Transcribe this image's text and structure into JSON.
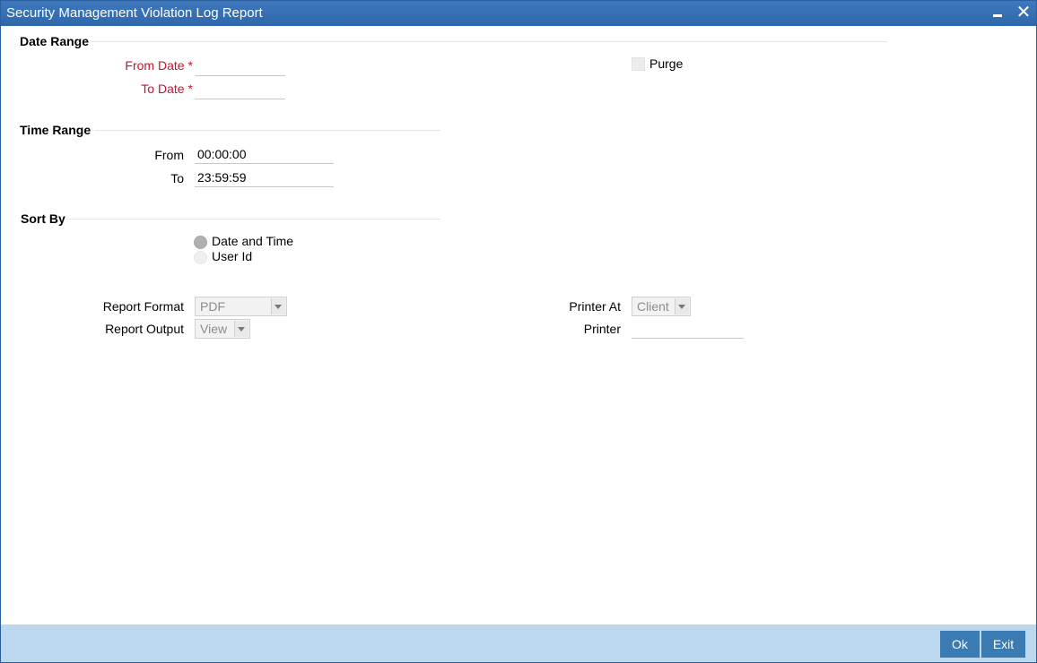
{
  "window": {
    "title": "Security Management Violation Log Report",
    "minimize_icon": "minimize-icon",
    "close_icon": "close-icon",
    "close_glyph": "✕"
  },
  "date_range": {
    "title": "Date Range",
    "from_label": "From Date",
    "to_label": "To Date",
    "required_mark": "*",
    "from_value": "",
    "to_value": "",
    "purge_label": "Purge",
    "purge_checked": false
  },
  "time_range": {
    "title": "Time Range",
    "from_label": "From",
    "from_value": "00:00:00",
    "to_label": "To",
    "to_value": "23:59:59"
  },
  "sort_by": {
    "title": "Sort By",
    "options": [
      {
        "label": "Date and Time",
        "checked": true
      },
      {
        "label": "User Id",
        "checked": false
      }
    ]
  },
  "report": {
    "format_label": "Report Format",
    "format_value": "PDF",
    "output_label": "Report Output",
    "output_value": "View",
    "printer_at_label": "Printer At",
    "printer_at_value": "Client",
    "printer_label": "Printer",
    "printer_value": ""
  },
  "footer": {
    "ok_label": "Ok",
    "exit_label": "Exit"
  },
  "colors": {
    "titlebar": "#2f67aa",
    "required_label": "#c8102e",
    "footer": "#bcd8ee",
    "button": "#3a7bb3"
  }
}
